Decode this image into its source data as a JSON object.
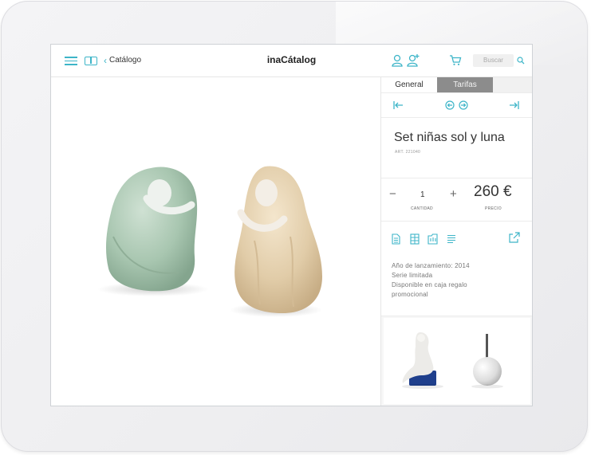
{
  "header": {
    "back_label": "Catálogo",
    "app_title": "inaCátalog",
    "search_placeholder": "Buscar"
  },
  "tabs": [
    "General",
    "Tarifas"
  ],
  "product": {
    "name": "Set niñas sol y luna",
    "art": "ART. 221040",
    "quantity": "1",
    "quantity_label": "CANTIDAD",
    "price": "260 €",
    "price_label": "PRECIO",
    "attributes": [
      "Año de lanzamiento: 2014",
      "Serie limitada",
      "Disponible en caja regalo",
      "promocional"
    ]
  },
  "colors": {
    "accent": "#3db5c8",
    "tab_active_bg": "#8c8c8c",
    "figure_green": "#a9c9b4",
    "figure_sand": "#e2cfae"
  },
  "icons": [
    "menu-icon",
    "catalog-book-icon",
    "chevron-left-icon",
    "user-icon",
    "add-user-icon",
    "cart-icon",
    "search-icon",
    "first-page-icon",
    "prev-icon",
    "next-icon",
    "last-page-icon",
    "document-icon",
    "gallery-icon",
    "folder-icon",
    "list-icon",
    "share-icon"
  ]
}
